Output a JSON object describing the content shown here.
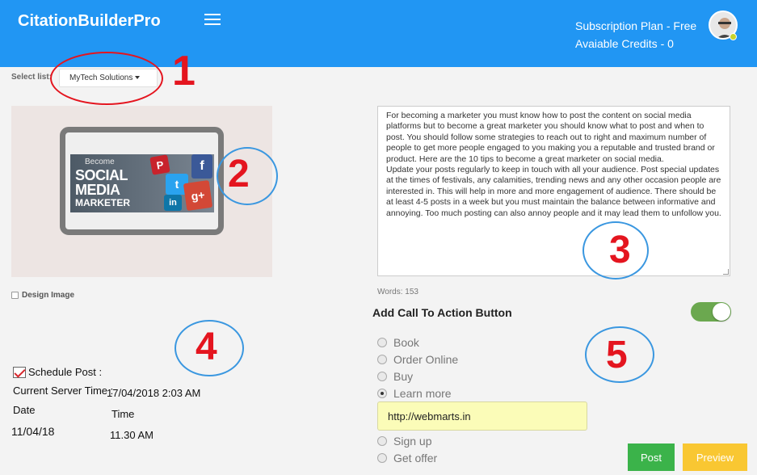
{
  "header": {
    "brand": "CitationBuilderPro",
    "subscription": "Subscription Plan - Free",
    "credits": "Avaiable Credits - 0",
    "colors": {
      "topbar": "#2196f3"
    }
  },
  "list_select": {
    "label": "Select list:",
    "value": "MyTech Solutions"
  },
  "image": {
    "promo_line1": "Become",
    "promo_line2": "SOCIAL",
    "promo_line3": "MEDIA",
    "promo_line4": "MARKETER",
    "design_label": "Design Image"
  },
  "post": {
    "paragraph1": "For becoming a marketer you must know how to post the content on social media platforms but to become a great marketer you should know what to post and when to post. You should follow some strategies to reach out to right and maximum number of people to get more people engaged to you making you a reputable and trusted brand or product. Here are the 10 tips to become a great marketer on social media.",
    "paragraph2": "Update your posts regularly to keep in touch with all your audience. Post special updates at the times of festivals, any calamities, trending news and any other occasion people are interested in. This will help in more and more engagement of audience. There should be at least 4-5 posts in a week but you must maintain the balance between informative and annoying. Too much posting can also annoy people and it may lead them to unfollow you.",
    "words": "Words: 153"
  },
  "cta": {
    "title": "Add Call To Action Button",
    "toggle_on": true,
    "options": [
      "Book",
      "Order Online",
      "Buy",
      "Learn more",
      "Sign up",
      "Get offer"
    ],
    "selected": "Learn more",
    "url": "http://webmarts.in"
  },
  "schedule": {
    "label": "Schedule Post :",
    "server_time_label": "Current Server Time :",
    "server_time": "17/04/2018 2:03 AM",
    "date_label": "Date",
    "time_label": "Time",
    "date": "11/04/18",
    "time": "11.30 AM"
  },
  "buttons": {
    "post": "Post",
    "preview": "Preview"
  },
  "annotations": [
    "1",
    "2",
    "3",
    "4",
    "5"
  ]
}
